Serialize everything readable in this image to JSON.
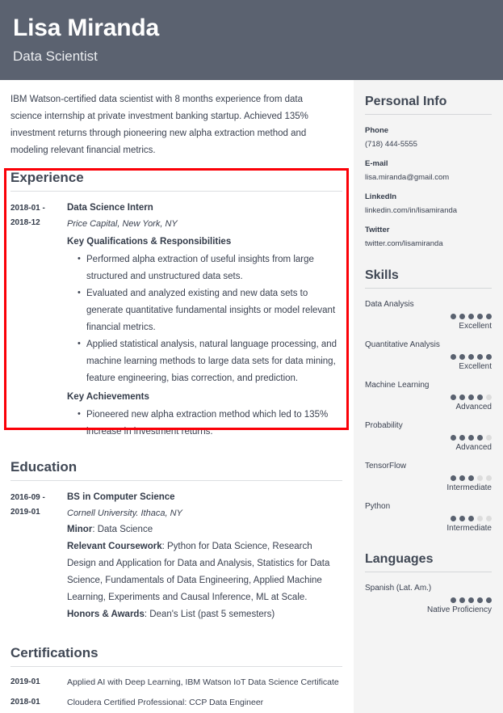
{
  "header": {
    "name": "Lisa Miranda",
    "job_title": "Data Scientist",
    "bg_color": "#5b6270"
  },
  "summary": "IBM Watson-certified data scientist with 8 months experience from data science internship at private investment banking startup. Achieved 135% investment returns through pioneering new alpha extraction method and modeling relevant financial metrics.",
  "highlight": {
    "color": "#fb0007",
    "target_section": "Experience"
  },
  "experience": {
    "title": "Experience",
    "entries": [
      {
        "date_start": "2018-01 -",
        "date_end": "2018-12",
        "role": "Data Science Intern",
        "org": "Price Capital, New York, NY",
        "groups": [
          {
            "heading": "Key Qualifications & Responsibilities",
            "bullets": [
              "Performed alpha extraction of useful insights from large structured and unstructured data sets.",
              "Evaluated and analyzed existing and new data sets to generate quantitative fundamental insights or model relevant financial metrics.",
              "Applied statistical analysis, natural language processing, and machine learning methods to large data sets for data mining, feature engineering, bias correction, and prediction."
            ]
          },
          {
            "heading": "Key Achievements",
            "bullets": [
              "Pioneered new alpha extraction method which led to 135% increase in investment returns."
            ]
          }
        ]
      }
    ]
  },
  "education": {
    "title": "Education",
    "entries": [
      {
        "date_start": "2016-09 -",
        "date_end": "2019-01",
        "degree": "BS in Computer Science",
        "school": "Cornell University. Ithaca, NY",
        "details": [
          {
            "label": "Minor",
            "value": ": Data Science"
          },
          {
            "label": "Relevant Coursework",
            "value": ": Python for Data Science, Research Design and Application for Data and Analysis, Statistics for Data Science, Fundamentals of Data Engineering, Applied Machine Learning, Experiments and Causal Inference, ML at Scale."
          },
          {
            "label": "Honors & Awards",
            "value": ": Dean's List (past 5 semesters)"
          }
        ]
      }
    ]
  },
  "certifications": {
    "title": "Certifications",
    "items": [
      {
        "date": "2019-01",
        "text": "Applied AI with Deep Learning, IBM Watson IoT Data Science Certificate"
      },
      {
        "date": "2018-01",
        "text": "Cloudera Certified Professional: CCP Data Engineer"
      }
    ]
  },
  "personal_info": {
    "title": "Personal Info",
    "fields": [
      {
        "label": "Phone",
        "value": "(718) 444-5555"
      },
      {
        "label": "E-mail",
        "value": "lisa.miranda@gmail.com"
      },
      {
        "label": "LinkedIn",
        "value": "linkedin.com/in/lisamiranda"
      },
      {
        "label": "Twitter",
        "value": "twitter.com/lisamiranda"
      }
    ]
  },
  "skills": {
    "title": "Skills",
    "max_rating": 5,
    "items": [
      {
        "name": "Data Analysis",
        "rating": 5,
        "level": "Excellent"
      },
      {
        "name": "Quantitative Analysis",
        "rating": 5,
        "level": "Excellent"
      },
      {
        "name": "Machine Learning",
        "rating": 4,
        "level": "Advanced"
      },
      {
        "name": "Probability",
        "rating": 4,
        "level": "Advanced"
      },
      {
        "name": "TensorFlow",
        "rating": 3,
        "level": "Intermediate"
      },
      {
        "name": "Python",
        "rating": 3,
        "level": "Intermediate"
      }
    ]
  },
  "languages": {
    "title": "Languages",
    "max_rating": 5,
    "items": [
      {
        "name": "Spanish (Lat. Am.)",
        "rating": 5,
        "level": "Native Proficiency"
      }
    ]
  }
}
